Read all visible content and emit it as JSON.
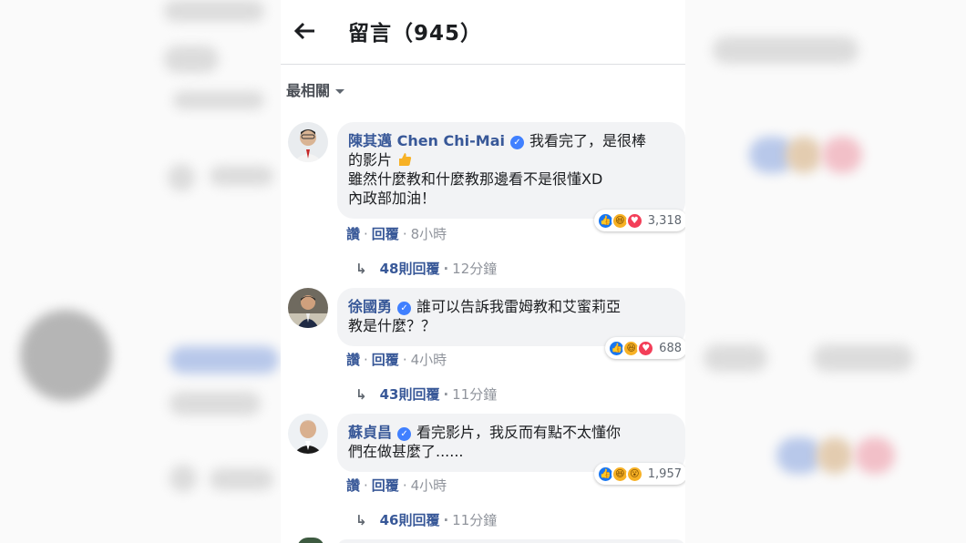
{
  "header": {
    "title": "留言（945）"
  },
  "sort": {
    "label": "最相關"
  },
  "comments": [
    {
      "author": "陳其邁 Chen Chi-Mai",
      "text_line1": "我看完了，是很棒",
      "text_line2": "的影片",
      "text_line3": "雖然什麼教和什麼教那邊看不是很懂XD",
      "text_line4": "內政部加油！",
      "reaction_count": "3,318",
      "like_label": "讚",
      "reply_label": "回覆",
      "time": "8小時",
      "replies_label": "48則回覆",
      "replies_time": "12分鐘"
    },
    {
      "author": "徐國勇",
      "text_line1": "誰可以告訴我雷姆教和艾蜜莉亞",
      "text_line2": "教是什麼？？",
      "reaction_count": "688",
      "like_label": "讚",
      "reply_label": "回覆",
      "time": "4小時",
      "replies_label": "43則回覆",
      "replies_time": "11分鐘"
    },
    {
      "author": "蘇貞昌",
      "text_line1": "看完影片，我反而有點不太懂你",
      "text_line2": "們在做甚麼了......",
      "reaction_count": "1,957",
      "like_label": "讚",
      "reply_label": "回覆",
      "time": "4小時",
      "replies_label": "46則回覆",
      "replies_time": "11分鐘"
    }
  ],
  "colors": {
    "link": "#385898",
    "bubble": "#f2f3f5",
    "like": "#1877f2",
    "love": "#f33e58",
    "haha": "#f7b125"
  },
  "icons": {
    "back": "arrow-left-icon",
    "caret": "caret-down-icon",
    "reply": "reply-arrow-icon",
    "thumbs": "thumbs-up-emoji-icon"
  }
}
